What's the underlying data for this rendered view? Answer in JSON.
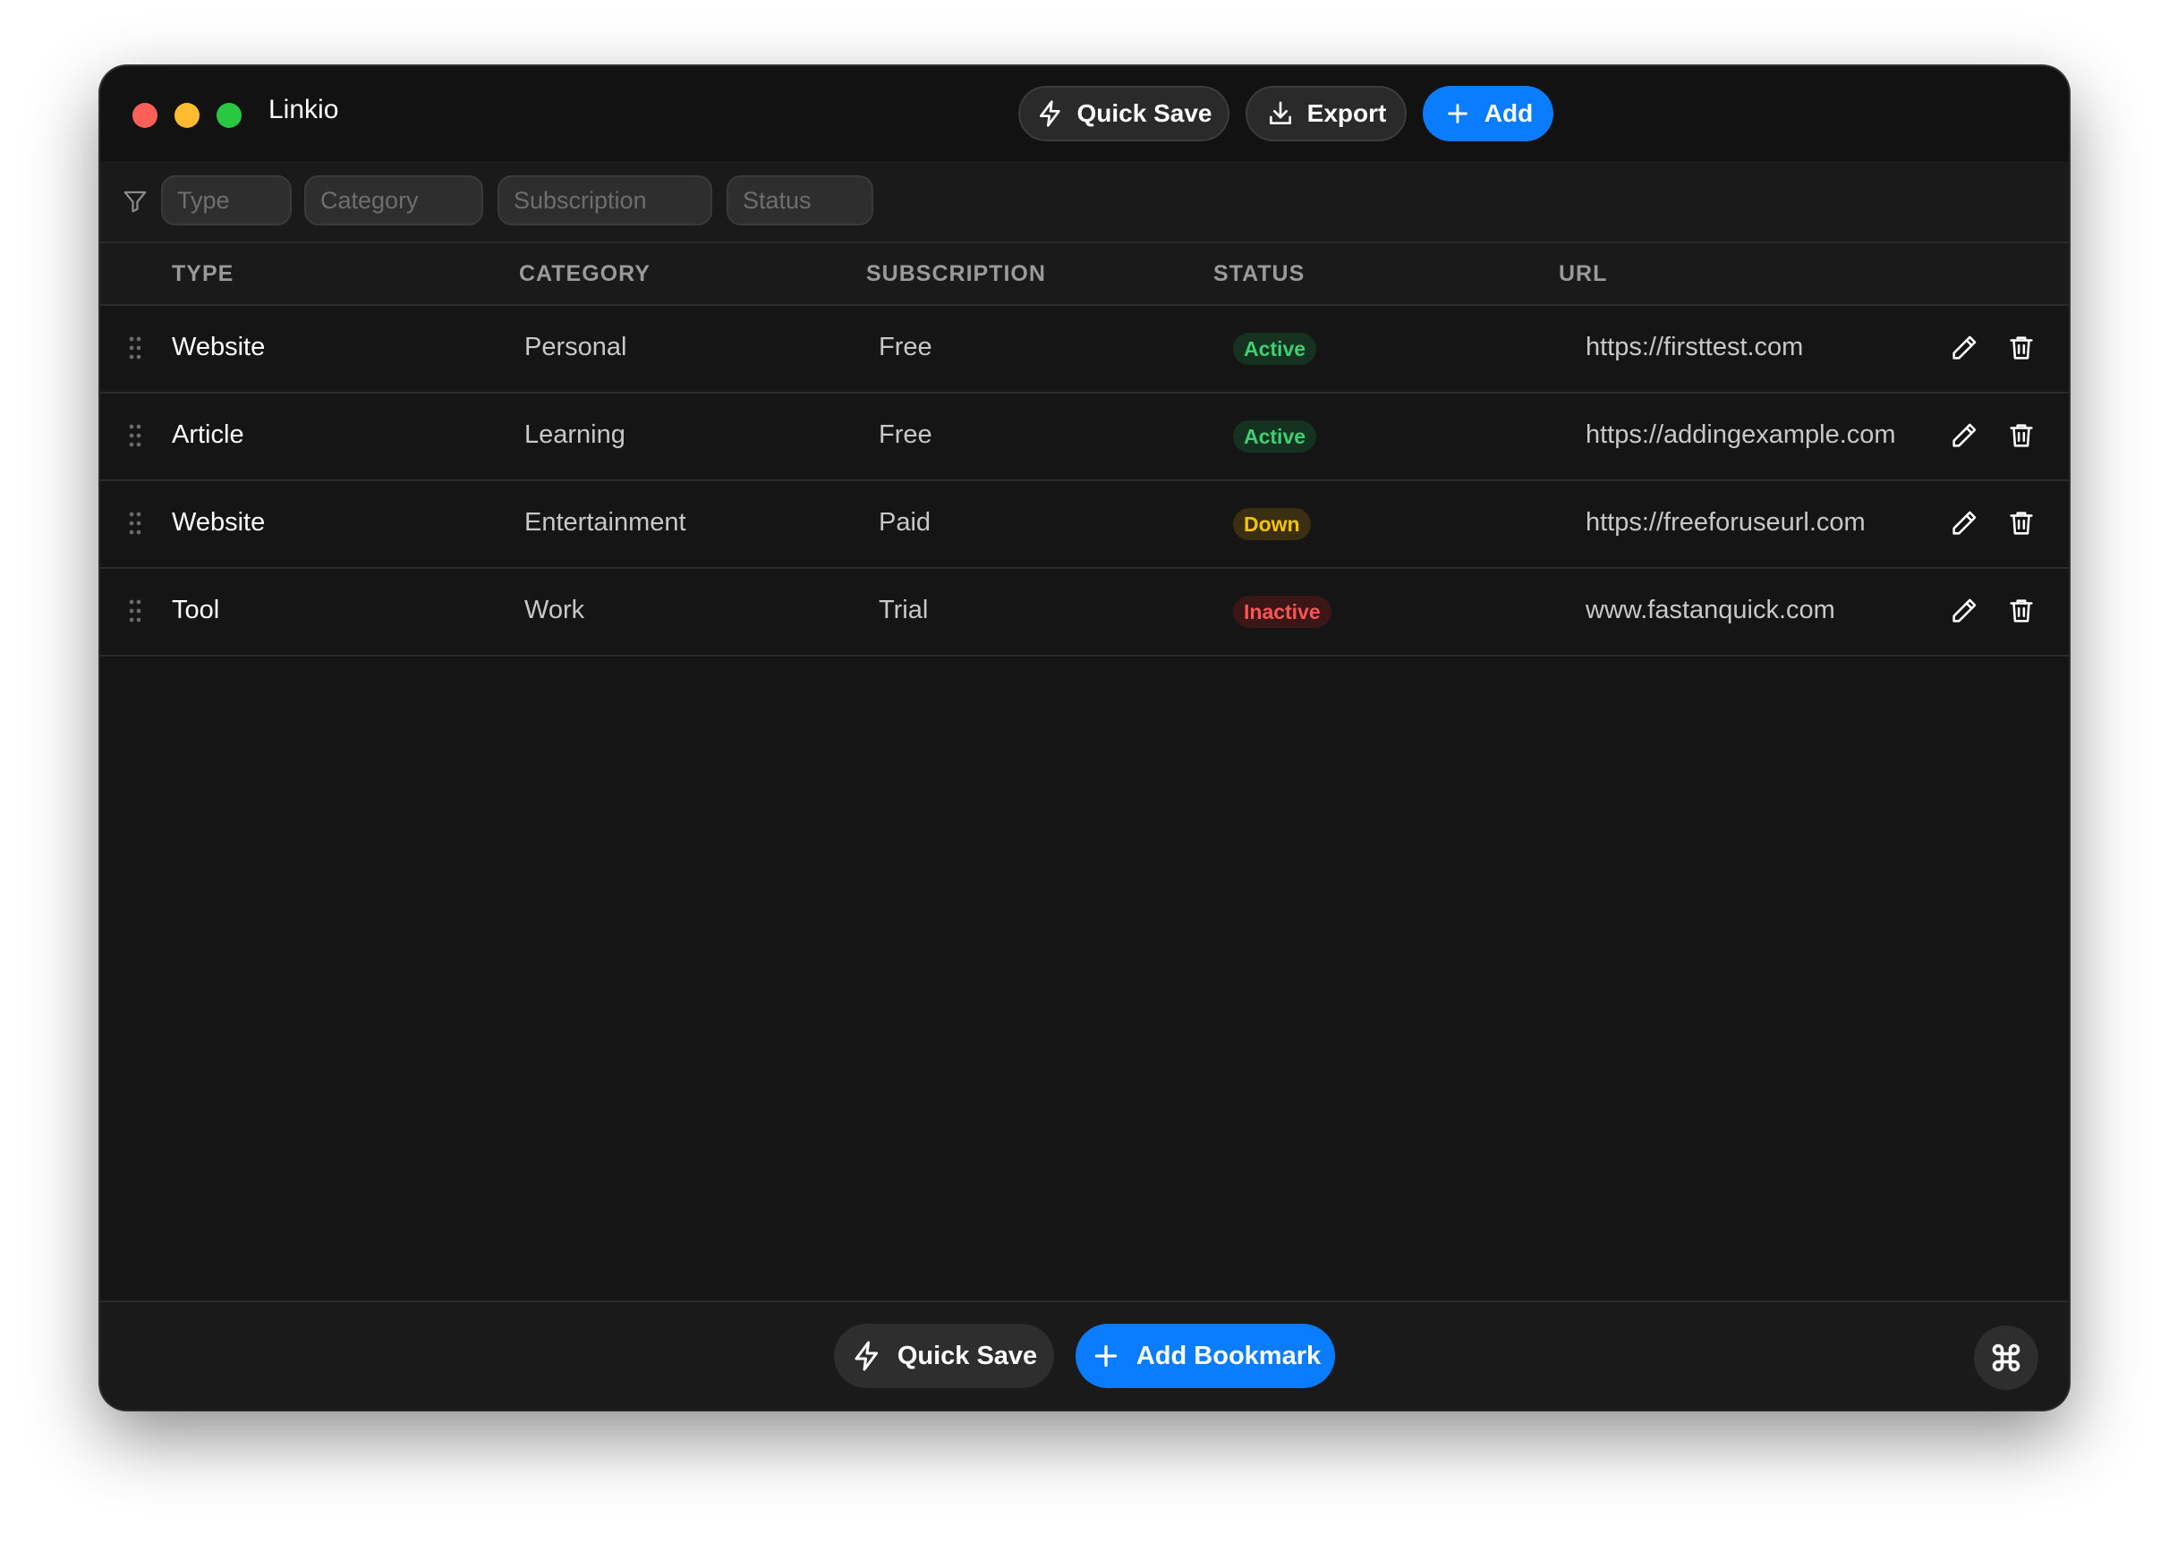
{
  "app": {
    "title": "Linkio"
  },
  "toolbar": {
    "quick_save_label": "Quick Save",
    "export_label": "Export",
    "add_label": "Add"
  },
  "filters": {
    "type": "Type",
    "category": "Category",
    "subscription": "Subscription",
    "status": "Status"
  },
  "table": {
    "columns": [
      "TYPE",
      "CATEGORY",
      "SUBSCRIPTION",
      "STATUS",
      "URL"
    ],
    "rows": [
      {
        "type": "Website",
        "category": "Personal",
        "subscription": "Free",
        "status": "Active",
        "url": "https://firsttest.com"
      },
      {
        "type": "Article",
        "category": "Learning",
        "subscription": "Free",
        "status": "Active",
        "url": "https://addingexample.com"
      },
      {
        "type": "Website",
        "category": "Entertainment",
        "subscription": "Paid",
        "status": "Down",
        "url": "https://freeforuseurl.com"
      },
      {
        "type": "Tool",
        "category": "Work",
        "subscription": "Trial",
        "status": "Inactive",
        "url": "www.fastanquick.com"
      }
    ]
  },
  "footer": {
    "quick_save_label": "Quick Save",
    "add_bookmark_label": "Add Bookmark"
  },
  "colors": {
    "accent": "#0a7cff",
    "active": "#3ecf72",
    "down": "#f5c400",
    "inactive": "#ff5555"
  },
  "icons": {
    "quick_save": "lightning-icon",
    "export": "download-icon",
    "add": "plus-icon",
    "filter": "filter-icon",
    "drag": "drag-handle-icon",
    "edit": "pencil-icon",
    "delete": "trash-icon",
    "command": "command-icon"
  }
}
